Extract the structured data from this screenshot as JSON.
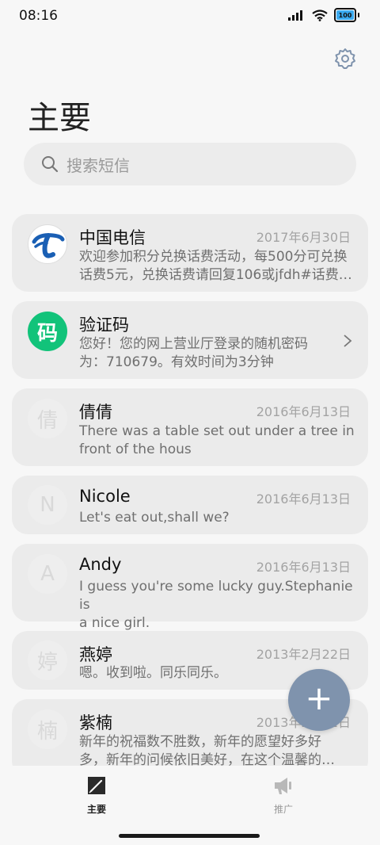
{
  "status": {
    "time": "08:16",
    "battery": "100"
  },
  "page": {
    "title": "主要"
  },
  "search": {
    "placeholder": "搜索短信"
  },
  "messages": [
    {
      "name": "中国电信",
      "date": "2017年6月30日",
      "line1": "欢迎参加积分兑换话费活动，每500分可兑换",
      "line2": "话费5元，兑换话费请回复106或jfdh#话费…"
    },
    {
      "name": "验证码",
      "avatar": "码",
      "line1": "您好！您的网上营业厅登录的随机密码",
      "line2": "为：710679。有效时间为3分钟"
    },
    {
      "name": "倩倩",
      "avatar": "倩",
      "date": "2016年6月13日",
      "line1": "There was a table set out under a tree in",
      "line2": "front of the hous"
    },
    {
      "name": "Nicole",
      "avatar": "N",
      "date": "2016年6月13日",
      "line1": "Let's eat out,shall we?"
    },
    {
      "name": "Andy",
      "avatar": "A",
      "date": "2016年6月13日",
      "line1": "I guess you're some lucky guy.Stephanie is",
      "line2": "a nice girl."
    },
    {
      "name": "燕婷",
      "avatar": "婷",
      "date": "2013年2月22日",
      "line1": "嗯。收到啦。同乐同乐。"
    },
    {
      "name": "紫楠",
      "avatar": "楠",
      "date": "2013年2月22日",
      "line1": "新年的祝福数不胜数，新年的愿望好多好",
      "line2": "多，新年的问候依旧美好，在这个温馨的…"
    }
  ],
  "fab": {
    "label": "+"
  },
  "nav": {
    "main": "主要",
    "promo": "推广"
  },
  "colors": {
    "accent": "#7f93ad",
    "verify_green": "#12c37a",
    "telecom_blue": "#1a5fb4"
  },
  "icons": [
    "signal-icon",
    "wifi-icon",
    "battery-icon",
    "gear-icon",
    "search-icon",
    "chevron-right-icon",
    "compose-icon",
    "megaphone-icon",
    "plus-icon"
  ]
}
